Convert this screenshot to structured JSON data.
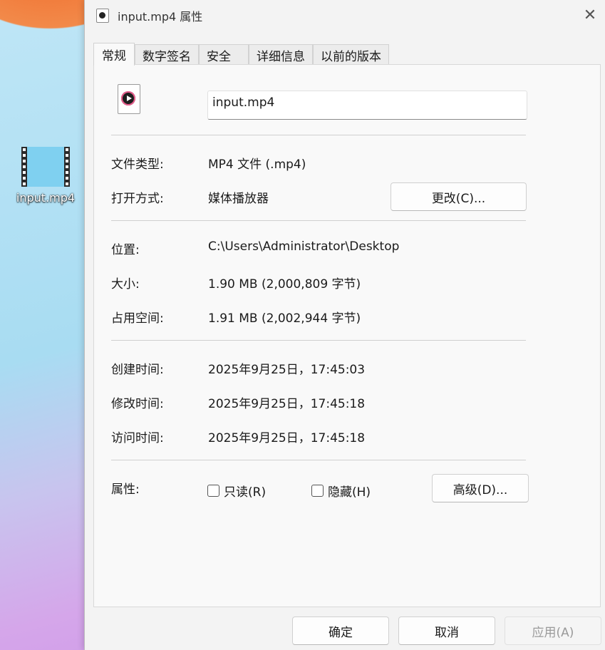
{
  "desktop": {
    "icon_label": "input.mp4"
  },
  "window": {
    "title": "input.mp4 属性",
    "close_glyph": "✕"
  },
  "tabs": [
    {
      "label": "常规",
      "active": true
    },
    {
      "label": "数字签名"
    },
    {
      "label": "安全"
    },
    {
      "label": "详细信息"
    },
    {
      "label": "以前的版本"
    }
  ],
  "general": {
    "file_name": "input.mp4",
    "file_type_label": "文件类型:",
    "file_type_value": "MP4 文件 (.mp4)",
    "open_with_label": "打开方式:",
    "open_with_value": "媒体播放器",
    "change_button": "更改(C)...",
    "location_label": "位置:",
    "location_value": "C:\\Users\\Administrator\\Desktop",
    "size_label": "大小:",
    "size_value": "1.90 MB (2,000,809 字节)",
    "size_on_disk_label": "占用空间:",
    "size_on_disk_value": "1.91 MB (2,002,944 字节)",
    "created_label": "创建时间:",
    "created_value": "2025年9月25日，17:45:03",
    "modified_label": "修改时间:",
    "modified_value": "2025年9月25日，17:45:18",
    "accessed_label": "访问时间:",
    "accessed_value": "2025年9月25日，17:45:18",
    "attributes_label": "属性:",
    "readonly_label": "只读(R)",
    "hidden_label": "隐藏(H)",
    "advanced_button": "高级(D)..."
  },
  "footer": {
    "ok": "确定",
    "cancel": "取消",
    "apply": "应用(A)"
  }
}
